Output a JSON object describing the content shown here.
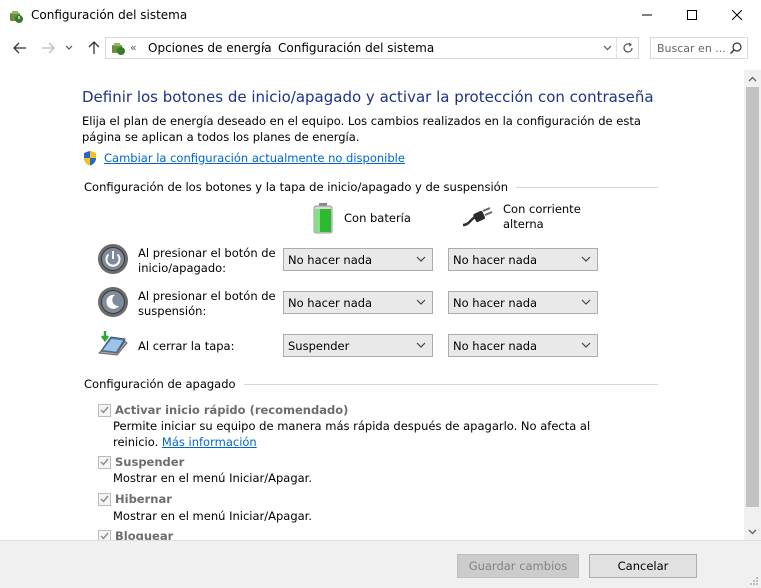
{
  "window": {
    "title": "Configuración del sistema",
    "icons": {
      "app": "power-options-icon",
      "minimize": "minimize-icon",
      "maximize": "maximize-icon",
      "close": "close-icon"
    }
  },
  "nav": {
    "breadcrumb_prefix": "«",
    "breadcrumb": [
      "Opciones de energía",
      "Configuración del sistema"
    ],
    "search_placeholder": "Buscar en ..."
  },
  "main": {
    "heading": "Definir los botones de inicio/apagado y activar la protección con contraseña",
    "intro": "Elija el plan de energía deseado en el equipo. Los cambios realizados en la configuración de esta página se aplican a todos los planes de energía.",
    "change_link": "Cambiar la configuración actualmente no disponible",
    "buttons_group_title": "Configuración de los botones y la tapa de inicio/apagado y de suspensión",
    "column_battery": "Con batería",
    "column_ac": "Con corriente alterna",
    "rows": [
      {
        "label": "Al presionar el botón de inicio/apagado:",
        "battery": "No hacer nada",
        "ac": "No hacer nada"
      },
      {
        "label": "Al presionar el botón de suspensión:",
        "battery": "No hacer nada",
        "ac": "No hacer nada"
      },
      {
        "label": "Al cerrar la tapa:",
        "battery": "Suspender",
        "ac": "No hacer nada"
      }
    ],
    "shutdown_group_title": "Configuración de apagado",
    "shutdown_items": [
      {
        "label": "Activar inicio rápido (recomendado)",
        "checked": true,
        "desc": "Permite iniciar su equipo de manera más rápida después de apagarlo. No afecta al reinicio.",
        "link": "Más información"
      },
      {
        "label": "Suspender",
        "checked": true,
        "desc": "Mostrar en el menú Iniciar/Apagar."
      },
      {
        "label": "Hibernar",
        "checked": true,
        "desc": "Mostrar en el menú Iniciar/Apagar."
      },
      {
        "label": "Bloquear",
        "checked": true
      }
    ]
  },
  "footer": {
    "save_label": "Guardar cambios",
    "cancel_label": "Cancelar"
  },
  "colors": {
    "heading": "#1e3287",
    "link": "#0066cc",
    "disabled_text": "#6d6d6d"
  }
}
